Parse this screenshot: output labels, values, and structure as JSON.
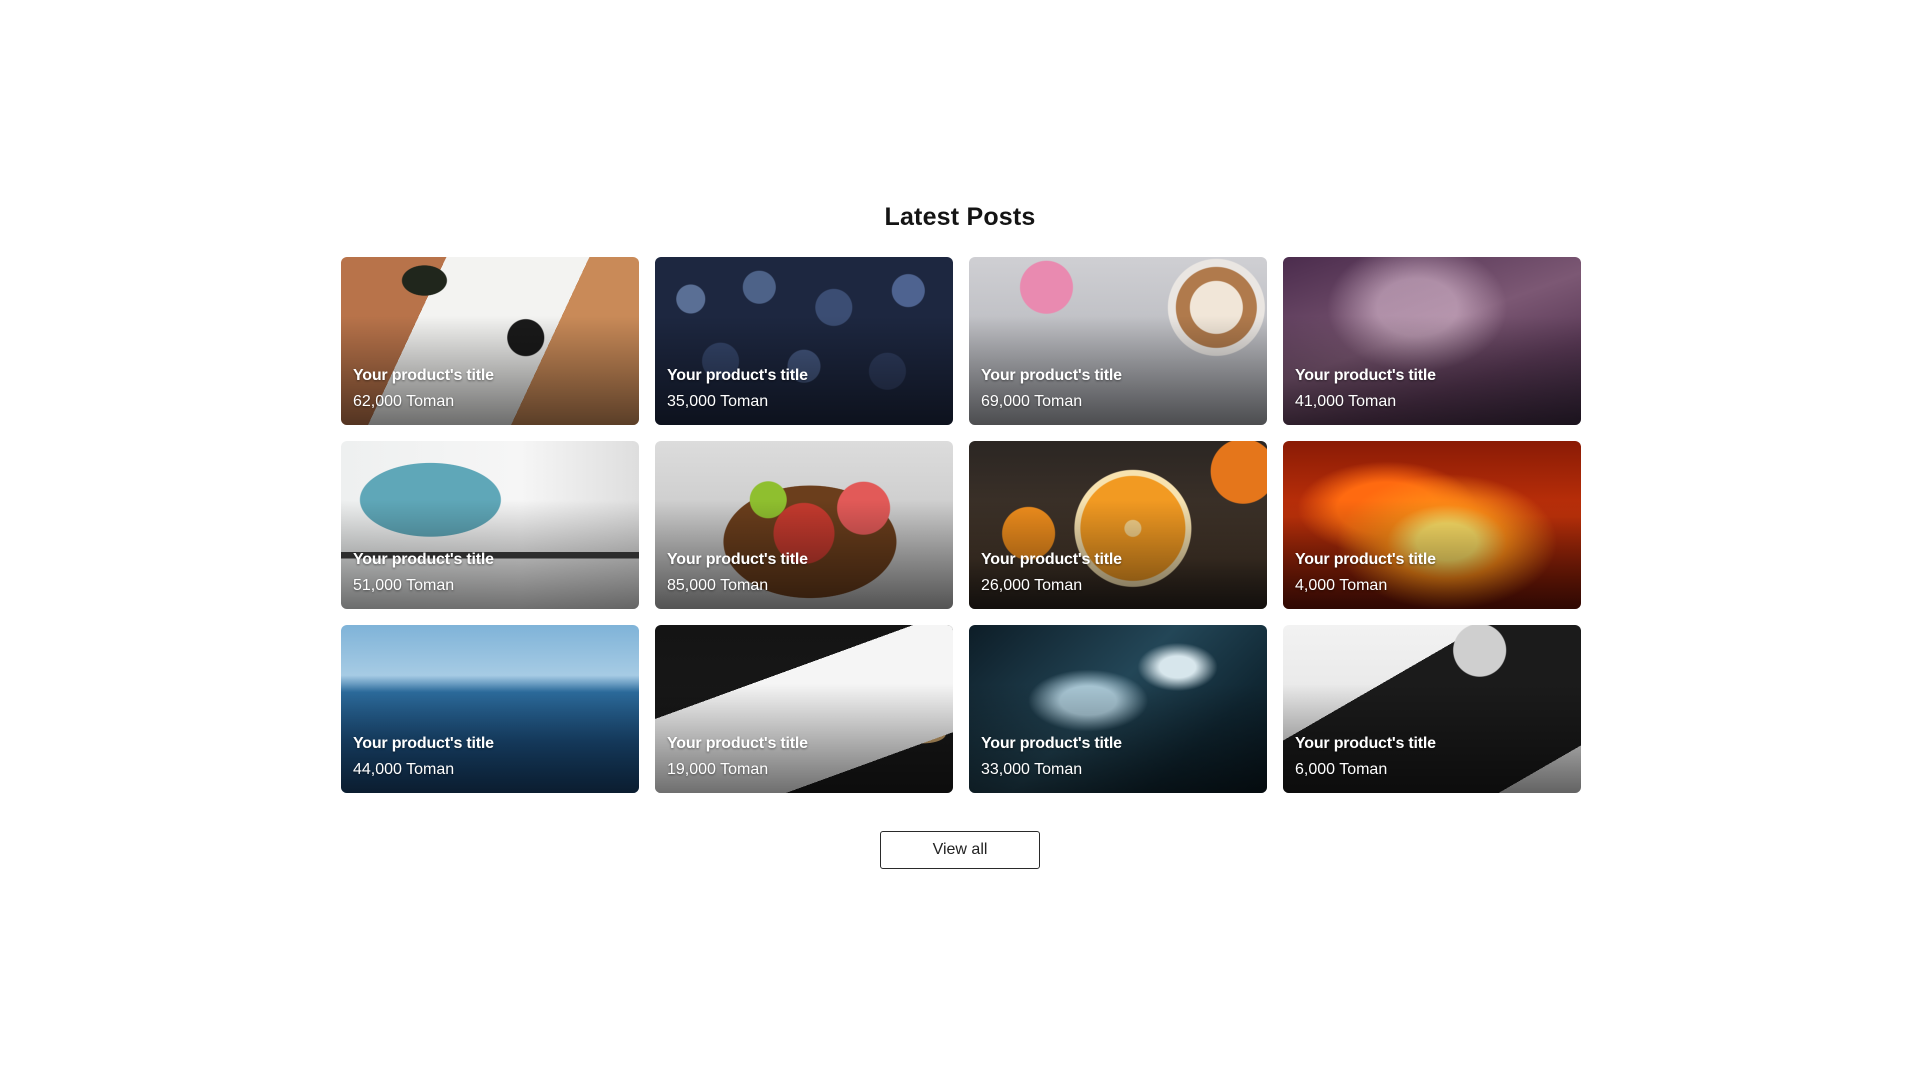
{
  "section": {
    "title": "Latest Posts",
    "view_all_label": "View all"
  },
  "cards": [
    {
      "title": "Your product's title",
      "price": "62,000 Toman",
      "image": "sunglasses-and-watch-photo"
    },
    {
      "title": "Your product's title",
      "price": "35,000 Toman",
      "image": "blueberries-photo"
    },
    {
      "title": "Your product's title",
      "price": "69,000 Toman",
      "image": "coffee-and-flowers-photo"
    },
    {
      "title": "Your product's title",
      "price": "41,000 Toman",
      "image": "galaxy-photo"
    },
    {
      "title": "Your product's title",
      "price": "51,000 Toman",
      "image": "desk-computer-photo"
    },
    {
      "title": "Your product's title",
      "price": "85,000 Toman",
      "image": "fruit-bowl-photo"
    },
    {
      "title": "Your product's title",
      "price": "26,000 Toman",
      "image": "orange-slices-photo"
    },
    {
      "title": "Your product's title",
      "price": "4,000 Toman",
      "image": "fire-photo"
    },
    {
      "title": "Your product's title",
      "price": "44,000 Toman",
      "image": "ocean-photo"
    },
    {
      "title": "Your product's title",
      "price": "19,000 Toman",
      "image": "paper-and-pen-photo"
    },
    {
      "title": "Your product's title",
      "price": "33,000 Toman",
      "image": "ice-water-photo"
    },
    {
      "title": "Your product's title",
      "price": "6,000 Toman",
      "image": "book-and-mug-photo"
    }
  ]
}
